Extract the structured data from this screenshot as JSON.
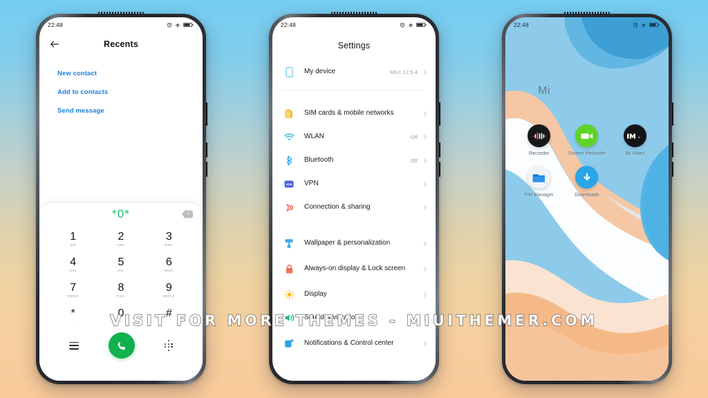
{
  "watermark": {
    "text": "VISIT  FOR  MORE  THEMES  -  MIUITHEMER.COM"
  },
  "colors": {
    "accent_blue": "#1b81e0",
    "green": "#11b14e",
    "dial_green": "#17c26a",
    "bg_top": "#74cdf2",
    "bg_bottom": "#f9cb9a"
  },
  "phones": [
    {
      "name": "recents-dialer",
      "status": {
        "time": "22:48",
        "icons": [
          "alarm-icon",
          "airplane-mode-icon",
          "battery-icon"
        ]
      },
      "header": {
        "back": "back-arrow-icon",
        "title": "Recents"
      },
      "actions": [
        {
          "label": "New contact"
        },
        {
          "label": "Add to contacts"
        },
        {
          "label": "Send message"
        }
      ],
      "dialer": {
        "number": "*0*",
        "backspace": "backspace-icon",
        "keys": [
          {
            "digit": "1",
            "letters": "QD"
          },
          {
            "digit": "2",
            "letters": "ABC"
          },
          {
            "digit": "3",
            "letters": "DEF"
          },
          {
            "digit": "4",
            "letters": "GHI"
          },
          {
            "digit": "5",
            "letters": "JKL"
          },
          {
            "digit": "6",
            "letters": "MNO"
          },
          {
            "digit": "7",
            "letters": "PQRS"
          },
          {
            "digit": "8",
            "letters": "TUV"
          },
          {
            "digit": "9",
            "letters": "WXYZ"
          },
          {
            "digit": "*",
            "letters": ","
          },
          {
            "digit": "0",
            "letters": "+"
          },
          {
            "digit": "#",
            "letters": ""
          }
        ],
        "bottom": [
          "list-icon",
          "call-button",
          "keypad-grid-icon"
        ]
      }
    },
    {
      "name": "settings",
      "status": {
        "time": "22:48",
        "icons": [
          "alarm-icon",
          "airplane-mode-icon",
          "battery-icon"
        ]
      },
      "title": "Settings",
      "items": [
        {
          "icon": "phone-device-icon",
          "label": "My device",
          "value": "MIUI 12.5.4",
          "group": 0
        },
        {
          "icon": "sim-cards-icon",
          "label": "SIM cards & mobile networks",
          "value": "",
          "group": 1
        },
        {
          "icon": "wlan-icon",
          "label": "WLAN",
          "value": "Off",
          "group": 1
        },
        {
          "icon": "bluetooth-icon",
          "label": "Bluetooth",
          "value": "Off",
          "group": 1
        },
        {
          "icon": "vpn-icon",
          "label": "VPN",
          "value": "",
          "group": 1
        },
        {
          "icon": "connection-sharing-icon",
          "label": "Connection & sharing",
          "value": "",
          "group": 1
        },
        {
          "icon": "wallpaper-icon",
          "label": "Wallpaper & personalization",
          "value": "",
          "group": 2
        },
        {
          "icon": "lock-screen-icon",
          "label": "Always-on display & Lock screen",
          "value": "",
          "group": 2
        },
        {
          "icon": "display-icon",
          "label": "Display",
          "value": "",
          "group": 2
        },
        {
          "icon": "sound-vibration-icon",
          "label": "Sound & vibration",
          "value": "",
          "group": 2
        },
        {
          "icon": "notifications-icon",
          "label": "Notifications & Control center",
          "value": "",
          "group": 2
        }
      ]
    },
    {
      "name": "home-screen",
      "status": {
        "time": "22:48",
        "icons": [
          "alarm-icon",
          "airplane-mode-icon",
          "battery-icon"
        ]
      },
      "widget": {
        "label": "Mi"
      },
      "apps": [
        {
          "icon": "recorder-icon",
          "label": "Recorder"
        },
        {
          "icon": "screen-recorder-icon",
          "label": "Screen Recorder"
        },
        {
          "icon": "mi-video-icon",
          "label": "Mi Video"
        },
        {
          "icon": "file-manager-icon",
          "label": "File Manager"
        },
        {
          "icon": "downloads-icon",
          "label": "Downloads"
        }
      ]
    }
  ]
}
